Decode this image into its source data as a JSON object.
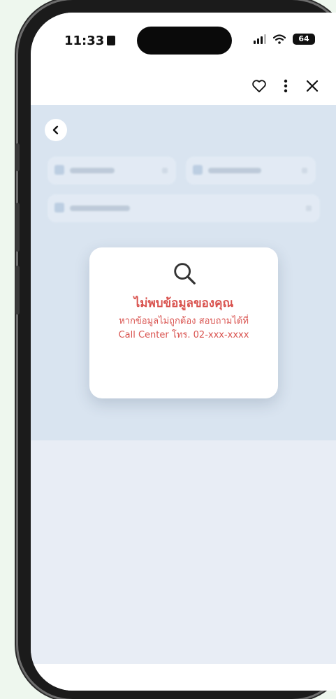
{
  "status_bar": {
    "time": "11:33",
    "battery": "64"
  },
  "app_bar": {
    "favorite_icon": "heart-outline-icon",
    "more_icon": "more-vertical-icon",
    "close_icon": "close-icon"
  },
  "content": {
    "back_icon": "chevron-left-icon"
  },
  "not_found_modal": {
    "icon": "search-icon",
    "title": "ไม่พบข้อมูลของคุณ",
    "subtitle_line1": "หากข้อมูลไม่ถูกต้อง สอบถามได้ที่",
    "subtitle_line2": "Call Center โทร. 02-xxx-xxxx",
    "color": "#d9534f"
  }
}
